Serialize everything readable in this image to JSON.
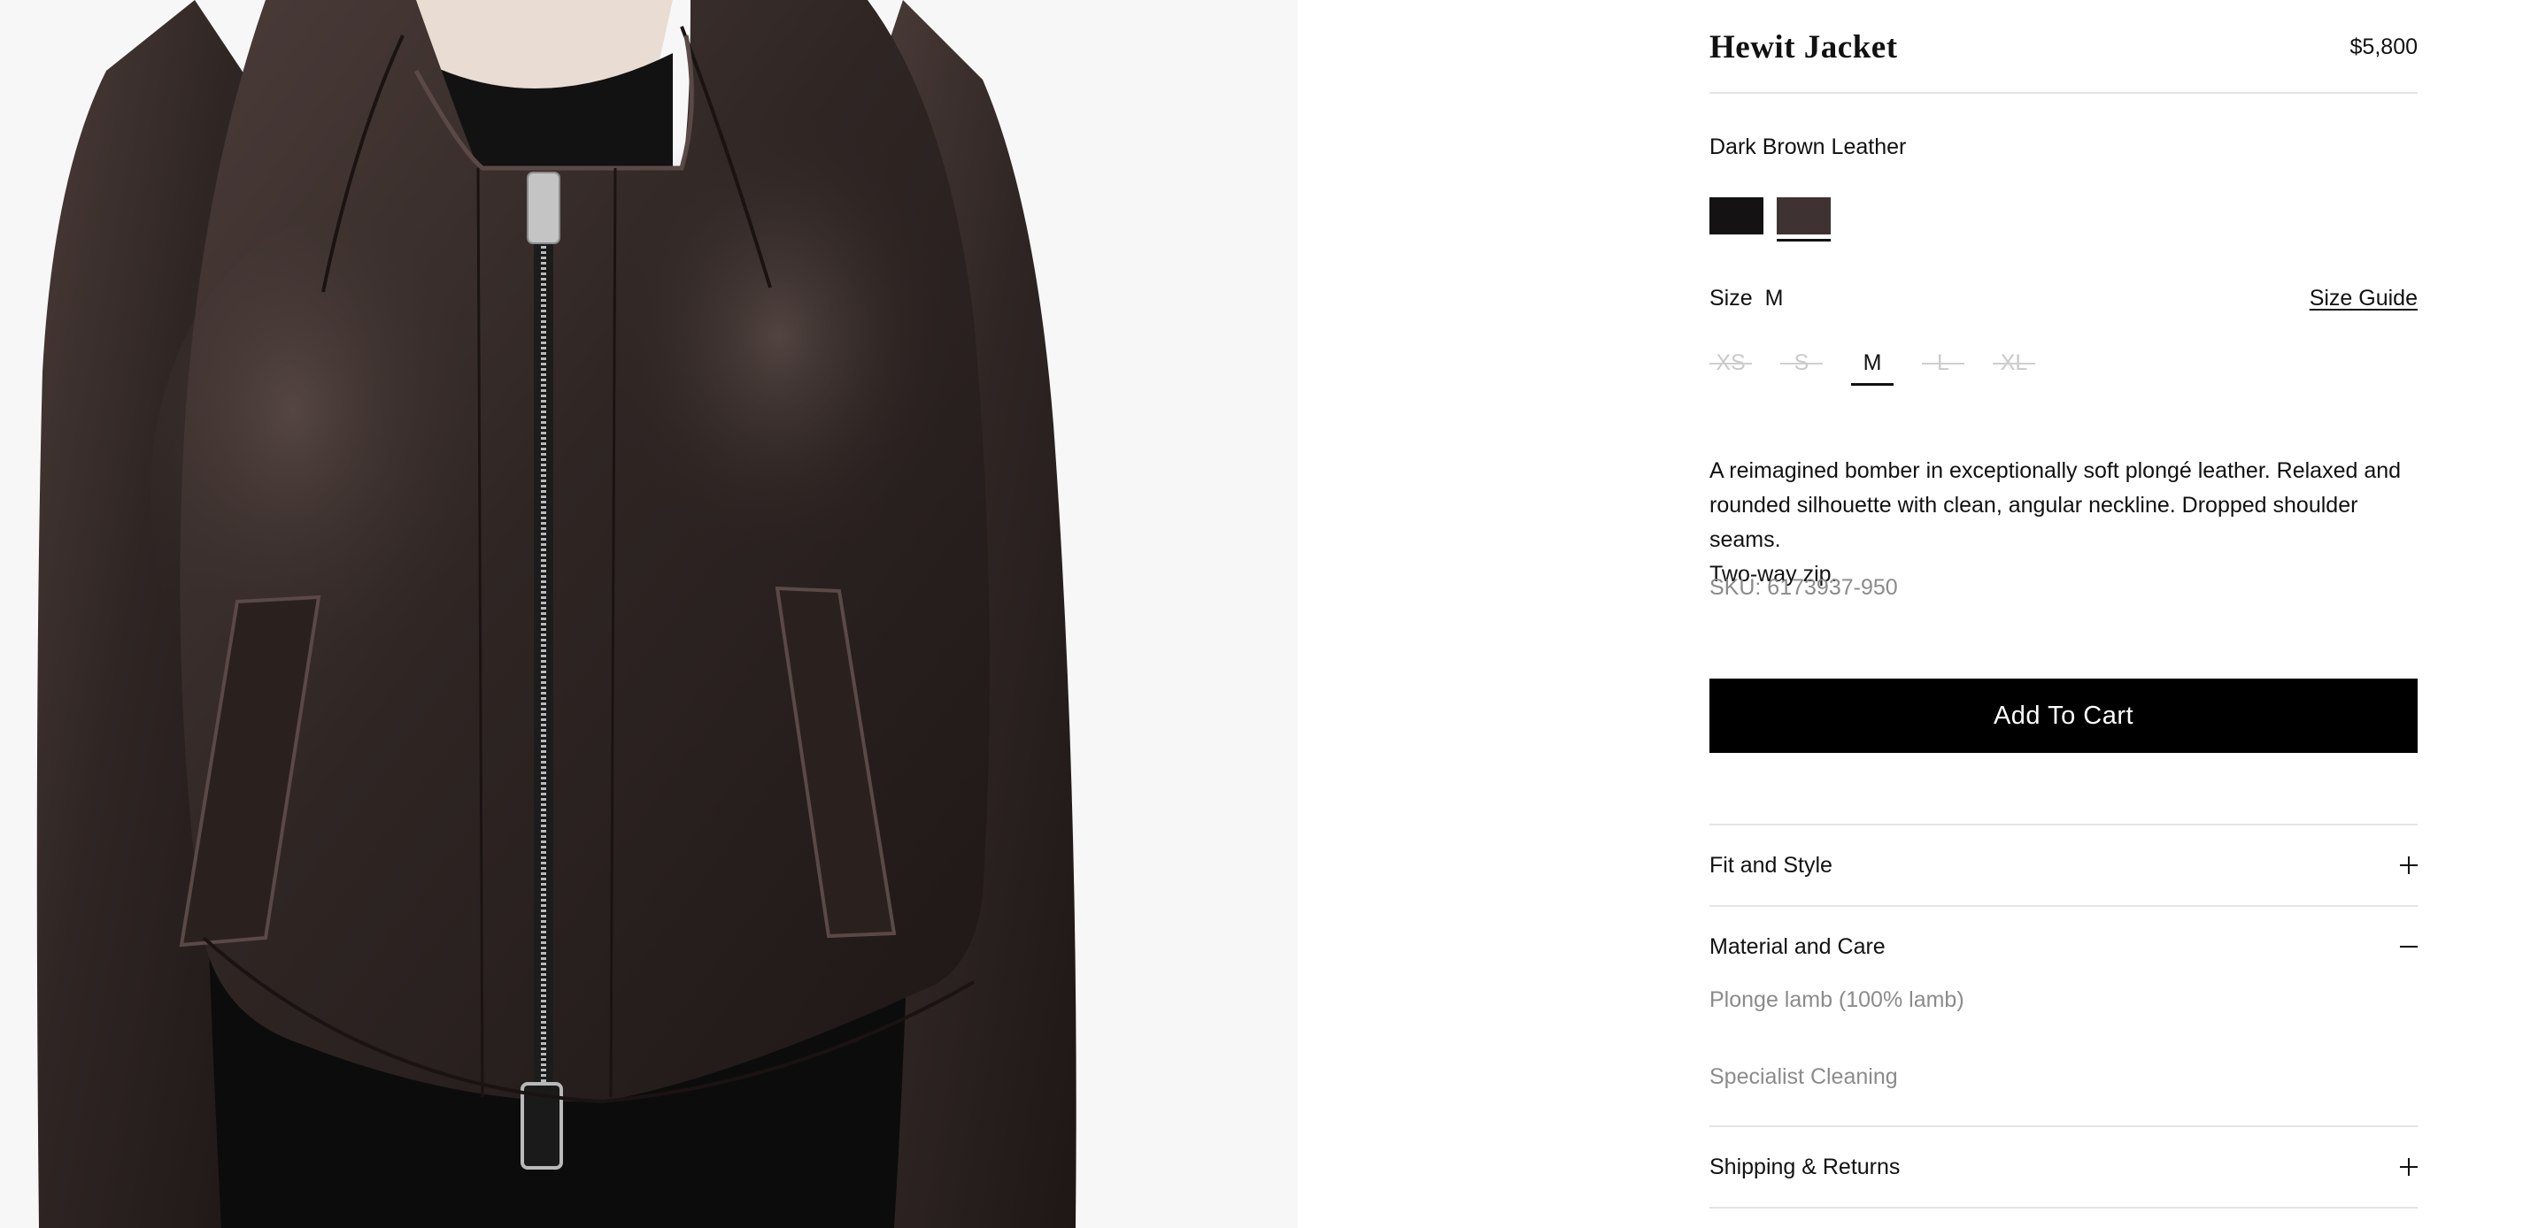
{
  "product": {
    "title": "Hewit Jacket",
    "price": "$5,800",
    "image_alt": "Dark brown leather bomber jacket with two-way zip"
  },
  "color": {
    "selected_name": "Dark Brown Leather",
    "swatches": [
      {
        "name": "black",
        "hex": "#141212"
      },
      {
        "name": "dark-brown",
        "hex": "#3e3332",
        "selected": true
      }
    ]
  },
  "size": {
    "label": "Size",
    "selected": "M",
    "guide_label": "Size Guide",
    "options": [
      {
        "label": "XS",
        "available": false
      },
      {
        "label": "S",
        "available": false
      },
      {
        "label": "M",
        "available": true,
        "selected": true
      },
      {
        "label": "L",
        "available": false
      },
      {
        "label": "XL",
        "available": false
      }
    ]
  },
  "description": {
    "line1": "A reimagined bomber in exceptionally soft plongé leather. Relaxed and",
    "line2": "rounded silhouette with clean, angular neckline. Dropped shoulder seams.",
    "line3": "Two-way zip.",
    "sku": "SKU: 6173937-950"
  },
  "cart": {
    "label": "Add To Cart"
  },
  "accordions": {
    "fit": {
      "label": "Fit and Style",
      "expanded": false
    },
    "material": {
      "label": "Material and Care",
      "expanded": true,
      "lines": [
        "Plonge lamb (100% lamb)",
        "Specialist Cleaning"
      ]
    },
    "shipping": {
      "label": "Shipping & Returns",
      "expanded": false
    }
  },
  "colors": {
    "leather": "#2f2624",
    "leather_highlight": "#5a4946",
    "undershirt": "#121212",
    "zipper": "#b9b9b9",
    "button_bg": "#000000",
    "muted_text": "#8b8b8b",
    "divider": "#e4e4e4"
  }
}
